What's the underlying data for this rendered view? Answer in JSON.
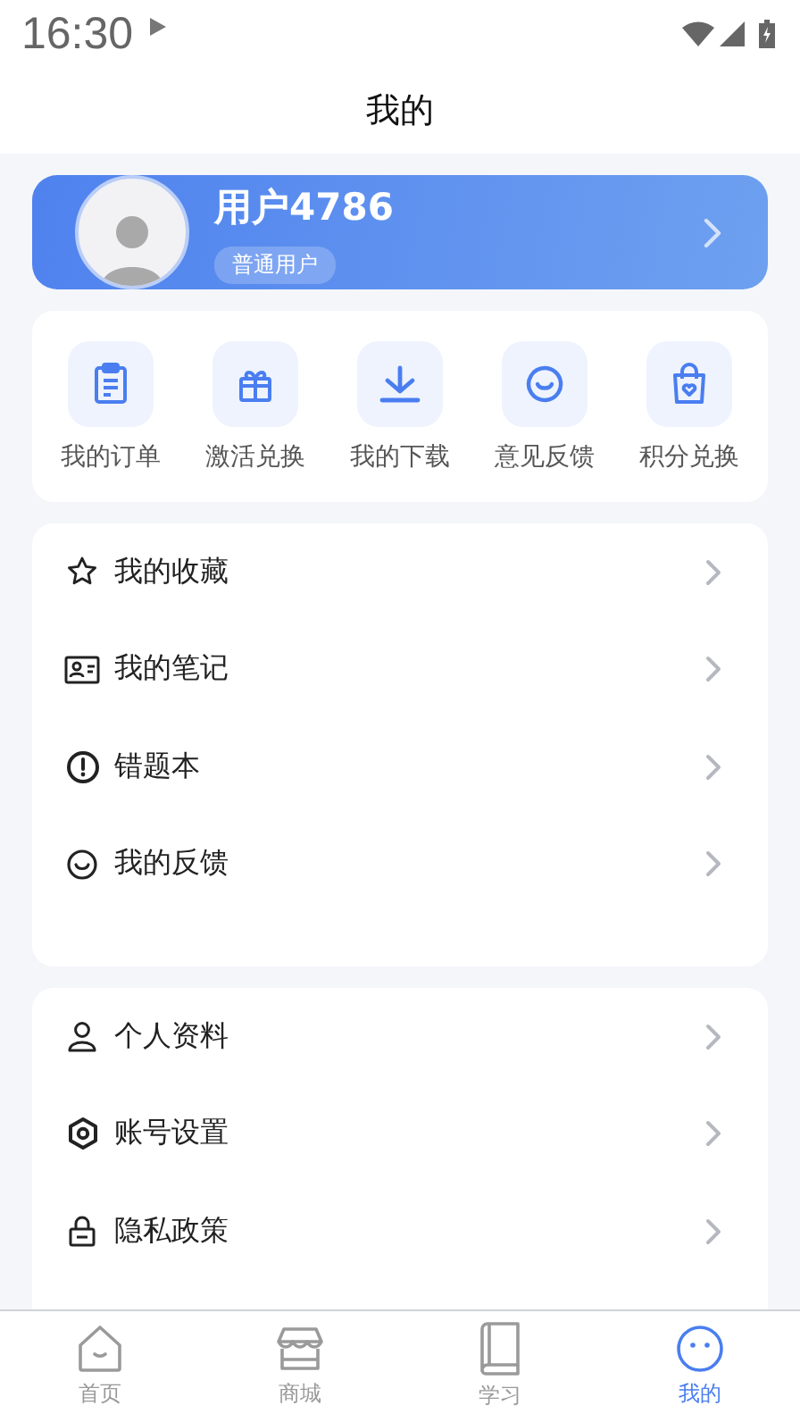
{
  "status_bar": {
    "time": "16:30"
  },
  "header": {
    "title": "我的"
  },
  "profile": {
    "name": "用户4786",
    "badge": "普通用户"
  },
  "shortcuts": [
    {
      "kind": "clipboard",
      "label": "我的订单"
    },
    {
      "kind": "gift",
      "label": "激活兑换"
    },
    {
      "kind": "download",
      "label": "我的下载"
    },
    {
      "kind": "smile",
      "label": "意见反馈"
    },
    {
      "kind": "bag",
      "label": "积分兑换"
    }
  ],
  "menu_groups": [
    [
      {
        "kind": "star",
        "label": "我的收藏"
      },
      {
        "kind": "card",
        "label": "我的笔记"
      },
      {
        "kind": "alert",
        "label": "错题本"
      },
      {
        "kind": "smile",
        "label": "我的反馈"
      }
    ],
    [
      {
        "kind": "person",
        "label": "个人资料"
      },
      {
        "kind": "hexagon",
        "label": "账号设置"
      },
      {
        "kind": "lock",
        "label": "隐私政策"
      }
    ]
  ],
  "tab_bar": [
    {
      "kind": "home",
      "label": "首页",
      "selected": false
    },
    {
      "kind": "store",
      "label": "商城",
      "selected": false
    },
    {
      "kind": "book",
      "label": "学习",
      "selected": false
    },
    {
      "kind": "face",
      "label": "我的",
      "selected": true
    }
  ]
}
